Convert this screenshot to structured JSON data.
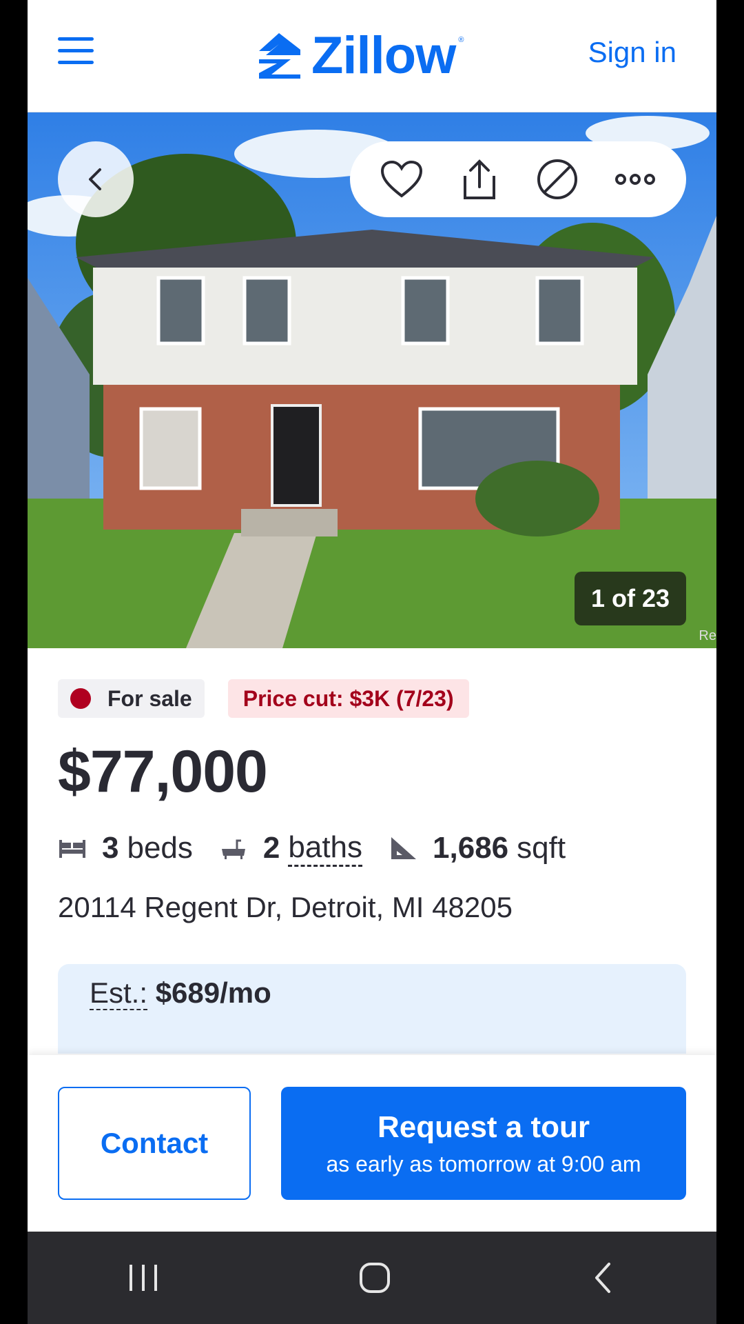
{
  "header": {
    "menu_icon": "hamburger-menu-icon",
    "brand": "Zillow",
    "sign_in": "Sign in"
  },
  "photo": {
    "counter": "1 of 23",
    "credit": "Re",
    "actions": [
      "back-icon",
      "heart-icon",
      "share-icon",
      "hide-icon",
      "more-icon"
    ]
  },
  "listing": {
    "status": "For sale",
    "price_cut": "Price cut: $3K (7/23)",
    "price": "$77,000",
    "beds_num": "3",
    "beds_unit": "beds",
    "baths_num": "2",
    "baths_unit": "baths",
    "sqft_num": "1,686",
    "sqft_unit": "sqft",
    "address": "20114 Regent Dr, Detroit, MI 48205",
    "est_label": "Est.:",
    "est_value": "$689/mo"
  },
  "actions": {
    "contact": "Contact",
    "tour_title": "Request a tour",
    "tour_sub": "as early as tomorrow at 9:00 am"
  },
  "system_nav": [
    "recent-apps-icon",
    "home-icon",
    "back-icon"
  ],
  "colors": {
    "brand_blue": "#0a6df2",
    "sale_dot": "#b00020",
    "price_cut_bg": "#fde4e6",
    "price_cut_text": "#a3001b",
    "est_bg": "#e6f1fd"
  }
}
